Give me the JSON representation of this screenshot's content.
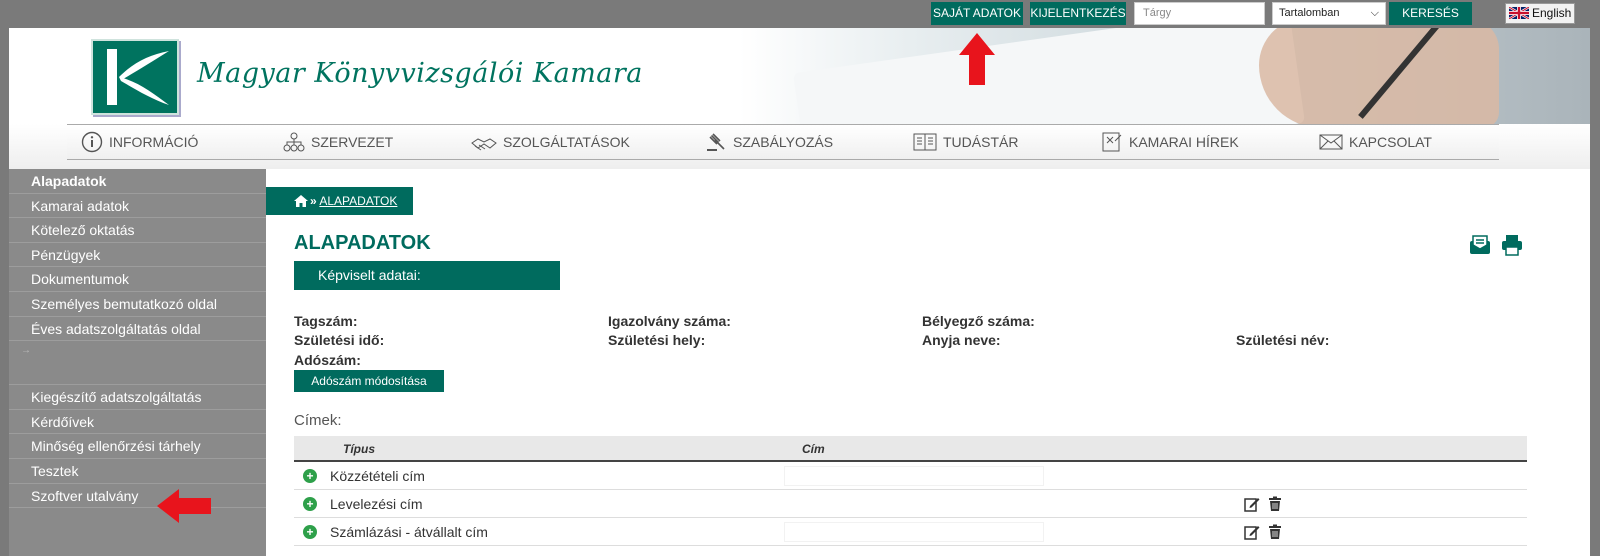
{
  "topbar": {
    "own_data": "SAJÁT ADATOK",
    "logout": "KIJELENTKEZÉS",
    "search_placeholder": "Tárgy",
    "search_scope": "Tartalomban",
    "search_button": "KERESÉS",
    "language": "English"
  },
  "header": {
    "site_title": "Magyar Könyvvizsgálói Kamara"
  },
  "nav": {
    "items": [
      "INFORMÁCIÓ",
      "SZERVEZET",
      "SZOLGÁLTATÁSOK",
      "SZABÁLYOZÁS",
      "TUDÁSTÁR",
      "KAMARAI HÍREK",
      "KAPCSOLAT"
    ]
  },
  "sidebar": {
    "items_top": [
      "Alapadatok",
      "Kamarai adatok",
      "Kötelező oktatás",
      "Pénzügyek",
      "Dokumentumok",
      "Személyes bemutatkozó oldal",
      "Éves adatszolgáltatás oldal"
    ],
    "items_bottom": [
      "Kiegészítő adatszolgáltatás",
      "Kérdőívek",
      "Minőség ellenőrzési tárhely",
      "Tesztek",
      "Szoftver utalvány"
    ]
  },
  "breadcrumb": {
    "separator": "»",
    "current": "ALAPADATOK"
  },
  "main": {
    "title": "ALAPADATOK",
    "section": "Képviselt adatai:",
    "fields": {
      "tagszam": "Tagszám:",
      "igazolvany": "Igazolvány száma:",
      "belyegzo": "Bélyegző száma:",
      "szul_ido": "Születési idő:",
      "szul_hely": "Születési hely:",
      "anyja": "Anyja neve:",
      "szul_nev": "Születési név:",
      "adoszam": "Adószám:"
    },
    "tax_button": "Adószám módosítása",
    "addresses_label": "Címek:",
    "table": {
      "headers": [
        "Típus",
        "Cím"
      ],
      "rows": [
        "Közzétételi cím",
        "Levelezési cím",
        "Számlázási - átvállalt cím"
      ]
    }
  },
  "colors": {
    "brand": "#006b5e",
    "sidebar": "#8a8a8a",
    "arrow": "#e8141c"
  }
}
